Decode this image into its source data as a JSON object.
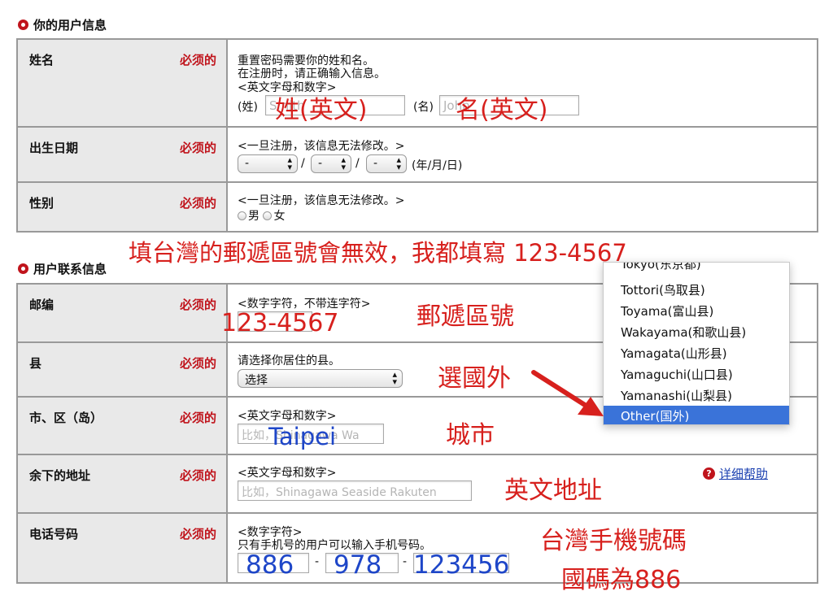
{
  "sections": {
    "personal_title": "你的用户信息",
    "contact_title": "用户联系信息"
  },
  "required_label": "必须的",
  "rows": {
    "name": {
      "label": "姓名",
      "line1": "重置密码需要你的姓和名。",
      "line2": "在注册时，请正确输入信息。",
      "line3": "<英文字母和数字>",
      "surname_prefix": "(姓)",
      "surname_placeholder": "Smith",
      "given_prefix": "(名)",
      "given_placeholder": "John"
    },
    "birthday": {
      "label": "出生日期",
      "line1": "<一旦注册，该信息无法修改。>",
      "year_value": "-",
      "month_value": "-",
      "day_value": "-",
      "sep": "/",
      "suffix": "(年/月/日)"
    },
    "gender": {
      "label": "性别",
      "line1": "<一旦注册，该信息无法修改。>",
      "male": "男",
      "female": "女"
    },
    "postal": {
      "label": "邮编",
      "line1": "<数字字符，不带连字符>"
    },
    "prefecture": {
      "label": "县",
      "line1": "请选择你居住的县。",
      "select_value": "选择"
    },
    "city": {
      "label": "市、区（岛）",
      "line1": "<英文字母和数字>",
      "placeholder": "比如，Shinagawa Wa"
    },
    "address": {
      "label": "余下的地址",
      "line1": "<英文字母和数字>",
      "placeholder": "比如，Shinagawa Seaside Rakuten",
      "help_link": "详细帮助"
    },
    "phone": {
      "label": "电话号码",
      "line1": "<数字字符>",
      "line2": "只有手机号的用户可以输入手机号码。",
      "dash": "-"
    }
  },
  "dropdown": {
    "items": [
      "Tokyo(东京都)",
      "Tottori(鸟取县)",
      "Toyama(富山县)",
      "Wakayama(和歌山县)",
      "Yamagata(山形县)",
      "Yamaguchi(山口县)",
      "Yamanashi(山梨县)",
      "Other(国外)"
    ],
    "selected_index": 7
  },
  "annotations": {
    "surname": "姓(英文)",
    "given": "名(英文)",
    "postal_warning": "填台灣的郵遞區號會無效，我都填寫 123-4567",
    "postal_value": "123-4567",
    "postal_hint": "郵遞區號",
    "prefecture_hint": "選國外",
    "city_value": "Taipei",
    "city_hint": "城市",
    "address_hint": "英文地址",
    "phone_country": "886",
    "phone_area": "978",
    "phone_number": "123456",
    "phone_hint": "台灣手機號碼",
    "phone_hint2": "國碼為886"
  },
  "colors": {
    "accent_red": "#c0141c",
    "annotation_red": "#d7201d",
    "annotation_blue": "#1e46c8",
    "dropdown_selected": "#3a73d9",
    "label_bg": "#e9e9e9"
  }
}
